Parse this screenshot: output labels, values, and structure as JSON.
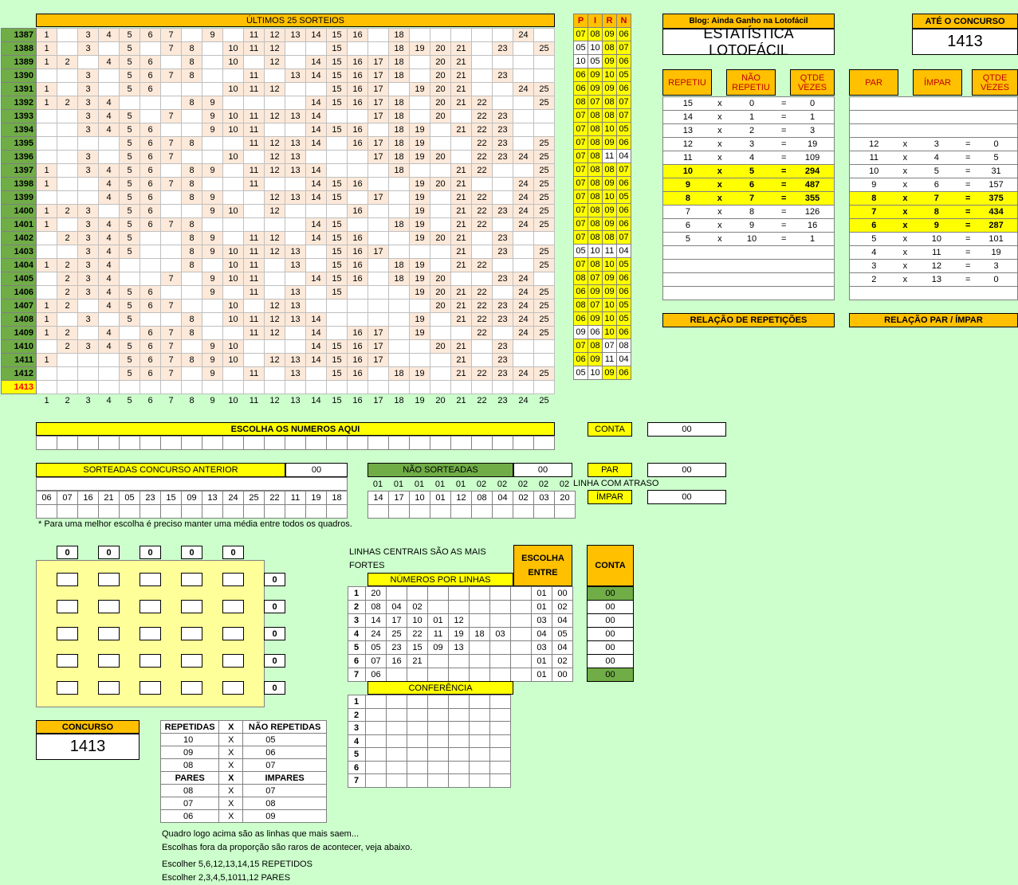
{
  "grid": {
    "title": "ÚLTIMOS 25 SORTEIOS",
    "column_numbers": [
      "1",
      "2",
      "3",
      "4",
      "5",
      "6",
      "7",
      "8",
      "9",
      "10",
      "11",
      "12",
      "13",
      "14",
      "15",
      "16",
      "17",
      "18",
      "19",
      "20",
      "21",
      "22",
      "23",
      "24",
      "25"
    ],
    "rows": [
      {
        "label": "1387",
        "nums": [
          1,
          3,
          4,
          5,
          6,
          7,
          9,
          11,
          12,
          13,
          14,
          15,
          16,
          18,
          24
        ]
      },
      {
        "label": "1388",
        "nums": [
          1,
          3,
          5,
          7,
          8,
          10,
          11,
          12,
          15,
          18,
          19,
          20,
          21,
          23,
          25
        ]
      },
      {
        "label": "1389",
        "nums": [
          1,
          2,
          4,
          5,
          6,
          8,
          10,
          12,
          14,
          15,
          16,
          17,
          18,
          20,
          21
        ]
      },
      {
        "label": "1390",
        "nums": [
          3,
          5,
          6,
          7,
          8,
          11,
          13,
          14,
          15,
          16,
          17,
          18,
          20,
          21,
          23
        ]
      },
      {
        "label": "1391",
        "nums": [
          1,
          3,
          5,
          6,
          10,
          11,
          12,
          15,
          16,
          17,
          19,
          20,
          21,
          24,
          25
        ]
      },
      {
        "label": "1392",
        "nums": [
          1,
          2,
          3,
          4,
          8,
          9,
          14,
          15,
          16,
          17,
          18,
          20,
          21,
          22,
          25
        ]
      },
      {
        "label": "1393",
        "nums": [
          3,
          4,
          5,
          7,
          9,
          10,
          11,
          12,
          13,
          14,
          17,
          18,
          20,
          22,
          23
        ]
      },
      {
        "label": "1394",
        "nums": [
          3,
          4,
          5,
          6,
          9,
          10,
          11,
          14,
          15,
          16,
          18,
          19,
          21,
          22,
          23
        ]
      },
      {
        "label": "1395",
        "nums": [
          5,
          6,
          7,
          8,
          11,
          12,
          13,
          14,
          16,
          17,
          18,
          19,
          22,
          23,
          25
        ]
      },
      {
        "label": "1396",
        "nums": [
          3,
          5,
          6,
          7,
          10,
          12,
          13,
          17,
          18,
          19,
          20,
          22,
          23,
          24,
          25
        ]
      },
      {
        "label": "1397",
        "nums": [
          1,
          3,
          4,
          5,
          6,
          8,
          9,
          11,
          12,
          13,
          14,
          18,
          21,
          22,
          25
        ]
      },
      {
        "label": "1398",
        "nums": [
          1,
          4,
          5,
          6,
          7,
          8,
          11,
          14,
          15,
          16,
          19,
          20,
          21,
          24,
          25
        ]
      },
      {
        "label": "1399",
        "nums": [
          4,
          5,
          6,
          8,
          9,
          12,
          13,
          14,
          15,
          17,
          19,
          21,
          22,
          24,
          25
        ]
      },
      {
        "label": "1400",
        "nums": [
          1,
          2,
          3,
          5,
          6,
          9,
          10,
          12,
          16,
          19,
          21,
          22,
          23,
          24,
          25
        ]
      },
      {
        "label": "1401",
        "nums": [
          1,
          3,
          4,
          5,
          6,
          7,
          8,
          14,
          15,
          18,
          19,
          21,
          22,
          24,
          25
        ]
      },
      {
        "label": "1402",
        "nums": [
          2,
          3,
          4,
          5,
          8,
          9,
          11,
          12,
          14,
          15,
          16,
          19,
          20,
          21,
          23
        ]
      },
      {
        "label": "1403",
        "nums": [
          3,
          4,
          5,
          8,
          9,
          10,
          11,
          12,
          13,
          15,
          16,
          17,
          21,
          23,
          25
        ]
      },
      {
        "label": "1404",
        "nums": [
          1,
          2,
          3,
          4,
          8,
          10,
          11,
          13,
          15,
          16,
          18,
          19,
          21,
          22,
          25
        ]
      },
      {
        "label": "1405",
        "nums": [
          2,
          3,
          4,
          7,
          9,
          10,
          11,
          14,
          15,
          16,
          18,
          19,
          20,
          23,
          24
        ]
      },
      {
        "label": "1406",
        "nums": [
          2,
          3,
          4,
          5,
          6,
          9,
          11,
          13,
          15,
          19,
          20,
          21,
          22,
          24,
          25
        ]
      },
      {
        "label": "1407",
        "nums": [
          1,
          2,
          4,
          5,
          6,
          7,
          10,
          12,
          13,
          20,
          21,
          22,
          23,
          24,
          25
        ]
      },
      {
        "label": "1408",
        "nums": [
          1,
          3,
          5,
          8,
          10,
          11,
          12,
          13,
          14,
          19,
          21,
          22,
          23,
          24,
          25
        ]
      },
      {
        "label": "1409",
        "nums": [
          1,
          2,
          4,
          6,
          7,
          8,
          11,
          12,
          14,
          16,
          17,
          19,
          22,
          24,
          25
        ]
      },
      {
        "label": "1410",
        "nums": [
          2,
          3,
          4,
          5,
          6,
          7,
          9,
          10,
          14,
          15,
          16,
          17,
          20,
          21,
          23
        ]
      },
      {
        "label": "1411",
        "nums": [
          1,
          5,
          6,
          7,
          8,
          9,
          10,
          12,
          13,
          14,
          15,
          16,
          17,
          21,
          23
        ]
      },
      {
        "label": "1412",
        "nums": [
          5,
          6,
          7,
          9,
          11,
          13,
          15,
          16,
          18,
          19,
          21,
          22,
          23,
          24,
          25
        ]
      },
      {
        "label": "1413",
        "nums": []
      }
    ]
  },
  "pirn": {
    "headers": [
      "P",
      "I",
      "R",
      "N"
    ],
    "rows": [
      [
        "07",
        "08",
        "09",
        "06"
      ],
      [
        "05",
        "10",
        "08",
        "07"
      ],
      [
        "10",
        "05",
        "09",
        "06"
      ],
      [
        "06",
        "09",
        "10",
        "05"
      ],
      [
        "06",
        "09",
        "09",
        "06"
      ],
      [
        "08",
        "07",
        "08",
        "07"
      ],
      [
        "07",
        "08",
        "08",
        "07"
      ],
      [
        "07",
        "08",
        "10",
        "05"
      ],
      [
        "07",
        "08",
        "09",
        "06"
      ],
      [
        "07",
        "08",
        "11",
        "04"
      ],
      [
        "07",
        "08",
        "08",
        "07"
      ],
      [
        "07",
        "08",
        "09",
        "06"
      ],
      [
        "07",
        "08",
        "10",
        "05"
      ],
      [
        "07",
        "08",
        "09",
        "06"
      ],
      [
        "07",
        "08",
        "09",
        "06"
      ],
      [
        "07",
        "08",
        "08",
        "07"
      ],
      [
        "05",
        "10",
        "11",
        "04"
      ],
      [
        "07",
        "08",
        "10",
        "05"
      ],
      [
        "08",
        "07",
        "09",
        "06"
      ],
      [
        "06",
        "09",
        "09",
        "06"
      ],
      [
        "08",
        "07",
        "10",
        "05"
      ],
      [
        "06",
        "09",
        "10",
        "05"
      ],
      [
        "09",
        "06",
        "10",
        "06"
      ],
      [
        "07",
        "08",
        "07",
        "08"
      ],
      [
        "06",
        "09",
        "11",
        "04"
      ],
      [
        "05",
        "10",
        "09",
        "06"
      ]
    ],
    "white_cells": [
      [
        1,
        0
      ],
      [
        1,
        1
      ],
      [
        2,
        0
      ],
      [
        2,
        1
      ],
      [
        9,
        2
      ],
      [
        9,
        3
      ],
      [
        16,
        0
      ],
      [
        16,
        1
      ],
      [
        16,
        2
      ],
      [
        16,
        3
      ],
      [
        22,
        0
      ],
      [
        22,
        1
      ],
      [
        23,
        2
      ],
      [
        23,
        3
      ],
      [
        24,
        2
      ],
      [
        24,
        3
      ],
      [
        25,
        0
      ],
      [
        25,
        1
      ]
    ]
  },
  "header": {
    "blog": "Blog: Ainda Ganho na Lotofácil",
    "title": "ESTATÍSTICA LOTOFÁCIL",
    "ate_label": "ATÉ O CONCURSO",
    "ate_value": "1413"
  },
  "repeticoes": {
    "headers": [
      "REPETIU",
      "NÃO REPETIU",
      "QTDE VEZES"
    ],
    "rows": [
      [
        "15",
        "x",
        "0",
        "=",
        "0"
      ],
      [
        "14",
        "x",
        "1",
        "=",
        "1"
      ],
      [
        "13",
        "x",
        "2",
        "=",
        "3"
      ],
      [
        "12",
        "x",
        "3",
        "=",
        "19"
      ],
      [
        "11",
        "x",
        "4",
        "=",
        "109"
      ],
      [
        "10",
        "x",
        "5",
        "=",
        "294"
      ],
      [
        "9",
        "x",
        "6",
        "=",
        "487"
      ],
      [
        "8",
        "x",
        "7",
        "=",
        "355"
      ],
      [
        "7",
        "x",
        "8",
        "=",
        "126"
      ],
      [
        "6",
        "x",
        "9",
        "=",
        "16"
      ],
      [
        "5",
        "x",
        "10",
        "=",
        "1"
      ]
    ],
    "highlight": [
      5,
      6,
      7
    ],
    "footer": "RELAÇÃO DE REPETIÇÕES"
  },
  "parimpar": {
    "headers": [
      "PAR",
      "ÍMPAR",
      "QTDE VEZES"
    ],
    "rows": [
      [
        "12",
        "x",
        "3",
        "=",
        "0"
      ],
      [
        "11",
        "x",
        "4",
        "=",
        "5"
      ],
      [
        "10",
        "x",
        "5",
        "=",
        "31"
      ],
      [
        "9",
        "x",
        "6",
        "=",
        "157"
      ],
      [
        "8",
        "x",
        "7",
        "=",
        "375"
      ],
      [
        "7",
        "x",
        "8",
        "=",
        "434"
      ],
      [
        "6",
        "x",
        "9",
        "=",
        "287"
      ],
      [
        "5",
        "x",
        "10",
        "=",
        "101"
      ],
      [
        "4",
        "x",
        "11",
        "=",
        "19"
      ],
      [
        "3",
        "x",
        "12",
        "=",
        "3"
      ],
      [
        "2",
        "x",
        "13",
        "=",
        "0"
      ]
    ],
    "highlight": [
      4,
      5,
      6
    ],
    "footer": "RELAÇÃO PAR / ÍMPAR"
  },
  "escolha": {
    "title": "ESCOLHA OS NUMEROS AQUI"
  },
  "conta": {
    "label": "CONTA",
    "value": "00"
  },
  "par": {
    "label": "PAR",
    "value": "00"
  },
  "impar": {
    "label": "ÍMPAR",
    "value": "00"
  },
  "sorteadas": {
    "title": "SORTEADAS CONCURSO ANTERIOR",
    "value": "00",
    "nums": [
      "06",
      "07",
      "16",
      "21",
      "05",
      "23",
      "15",
      "09",
      "13",
      "24",
      "25",
      "22",
      "11",
      "19",
      "18"
    ]
  },
  "nao_sorteadas": {
    "title": "NÃO SORTEADAS",
    "value": "00",
    "atraso": [
      "01",
      "01",
      "01",
      "01",
      "01",
      "02",
      "02",
      "02",
      "02",
      "02"
    ],
    "atraso_label": "LINHA COM ATRASO",
    "nums": [
      "14",
      "17",
      "10",
      "01",
      "12",
      "08",
      "04",
      "02",
      "03",
      "20"
    ]
  },
  "note": "* Para uma melhor escolha é preciso manter uma média entre todos os quadros.",
  "quadro": {
    "col_counts": [
      "0",
      "0",
      "0",
      "0",
      "0"
    ],
    "row_counts": [
      "0",
      "0",
      "0",
      "0",
      "0"
    ]
  },
  "linhas": {
    "intro": "LINHAS CENTRAIS SÃO AS MAIS FORTES",
    "title": "NÚMEROS POR LINHAS",
    "escolha_label": "ESCOLHA ENTRE",
    "conta_label": "CONTA",
    "rows": [
      {
        "n": "1",
        "nums": [
          "20"
        ],
        "a": "01",
        "b": "00",
        "conta": "00",
        "g": true
      },
      {
        "n": "2",
        "nums": [
          "08",
          "04",
          "02"
        ],
        "a": "01",
        "b": "02",
        "conta": "00",
        "g": false
      },
      {
        "n": "3",
        "nums": [
          "14",
          "17",
          "10",
          "01",
          "12"
        ],
        "a": "03",
        "b": "04",
        "conta": "00",
        "g": false
      },
      {
        "n": "4",
        "nums": [
          "24",
          "25",
          "22",
          "11",
          "19",
          "18",
          "03"
        ],
        "a": "04",
        "b": "05",
        "conta": "00",
        "g": false
      },
      {
        "n": "5",
        "nums": [
          "05",
          "23",
          "15",
          "09",
          "13"
        ],
        "a": "03",
        "b": "04",
        "conta": "00",
        "g": false
      },
      {
        "n": "6",
        "nums": [
          "07",
          "16",
          "21"
        ],
        "a": "01",
        "b": "02",
        "conta": "00",
        "g": false
      },
      {
        "n": "7",
        "nums": [
          "06"
        ],
        "a": "01",
        "b": "00",
        "conta": "00",
        "g": true
      }
    ]
  },
  "conferencia": {
    "title": "CONFERÊNCIA",
    "rows": [
      "1",
      "2",
      "3",
      "4",
      "5",
      "6",
      "7"
    ]
  },
  "concurso": {
    "label": "CONCURSO",
    "value": "1413"
  },
  "rep_table": {
    "h1": [
      "REPETIDAS",
      "X",
      "NÃO REPETIDAS"
    ],
    "r1": [
      [
        "10",
        "X",
        "05"
      ],
      [
        "09",
        "X",
        "06"
      ],
      [
        "08",
        "X",
        "07"
      ]
    ],
    "h2": [
      "PARES",
      "X",
      "IMPARES"
    ],
    "r2": [
      [
        "08",
        "X",
        "07"
      ],
      [
        "07",
        "X",
        "08"
      ],
      [
        "06",
        "X",
        "09"
      ]
    ]
  },
  "notes": [
    "Quadro logo acima são as linhas que mais saem...",
    "Escolhas fora da proporção são raros de acontecer, veja abaixo.",
    "Escolher 5,6,12,13,14,15 REPETIDOS",
    "Escolher 2,3,4,5,1011,12 PARES"
  ]
}
